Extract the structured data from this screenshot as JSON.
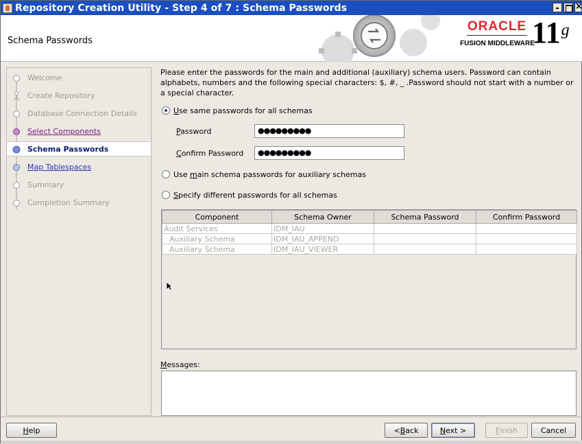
{
  "window": {
    "title": "Repository Creation Utility - Step 4 of 7 : Schema Passwords"
  },
  "header": {
    "page_title": "Schema Passwords",
    "brand_oracle": "ORACLE",
    "brand_fusion": "FUSION MIDDLEWARE",
    "brand_version": "11",
    "brand_version_suffix": "g"
  },
  "nav": {
    "items": [
      {
        "label": "Welcome",
        "state": "inactive"
      },
      {
        "label": "Create Repository",
        "state": "inactive"
      },
      {
        "label": "Database Connection Details",
        "state": "inactive"
      },
      {
        "label": "Select Components",
        "state": "visited"
      },
      {
        "label": "Schema Passwords",
        "state": "current"
      },
      {
        "label": "Map Tablespaces",
        "state": "link"
      },
      {
        "label": "Summary",
        "state": "inactive"
      },
      {
        "label": "Completion Summary",
        "state": "inactive"
      }
    ]
  },
  "content": {
    "instructions": "Please enter the passwords for the main and additional (auxiliary) schema users. Password can contain alphabets, numbers and the following special characters: $, #, _ .Password should not start with a number or a special character.",
    "option_same": {
      "pre": "",
      "mnemonic": "U",
      "post": "se same passwords for all schemas",
      "selected": true
    },
    "password_label": {
      "mnemonic": "P",
      "post": "assword"
    },
    "password_value": "●●●●●●●●●",
    "confirm_label": {
      "mnemonic": "C",
      "post": "onfirm Password"
    },
    "confirm_value": "●●●●●●●●●",
    "option_main": {
      "pre": "Use ",
      "mnemonic": "m",
      "post": "ain schema passwords for auxiliary schemas",
      "selected": false
    },
    "option_different": {
      "pre": "",
      "mnemonic": "S",
      "post": "pecify different passwords for all schemas",
      "selected": false
    },
    "table": {
      "columns": [
        "Component",
        "Schema Owner",
        "Schema Password",
        "Confirm Password"
      ],
      "rows": [
        {
          "component": "Audit Services",
          "owner": "IDM_IAU",
          "password": "",
          "confirm": ""
        },
        {
          "component": "Auxiliary Schema",
          "owner": "IDM_IAU_APPEND",
          "password": "",
          "confirm": ""
        },
        {
          "component": "Auxiliary Schema",
          "owner": "IDM_IAU_VIEWER",
          "password": "",
          "confirm": ""
        }
      ]
    },
    "messages_label": {
      "mnemonic": "M",
      "post": "essages:"
    },
    "messages_text": ""
  },
  "footer": {
    "help": {
      "mnemonic": "H",
      "post": "elp"
    },
    "back": {
      "pre": "< ",
      "mnemonic": "B",
      "post": "ack"
    },
    "next": {
      "pre": "",
      "mnemonic": "N",
      "post": "ext >"
    },
    "finish": {
      "mnemonic": "F",
      "post": "inish"
    },
    "cancel": "Cancel"
  }
}
